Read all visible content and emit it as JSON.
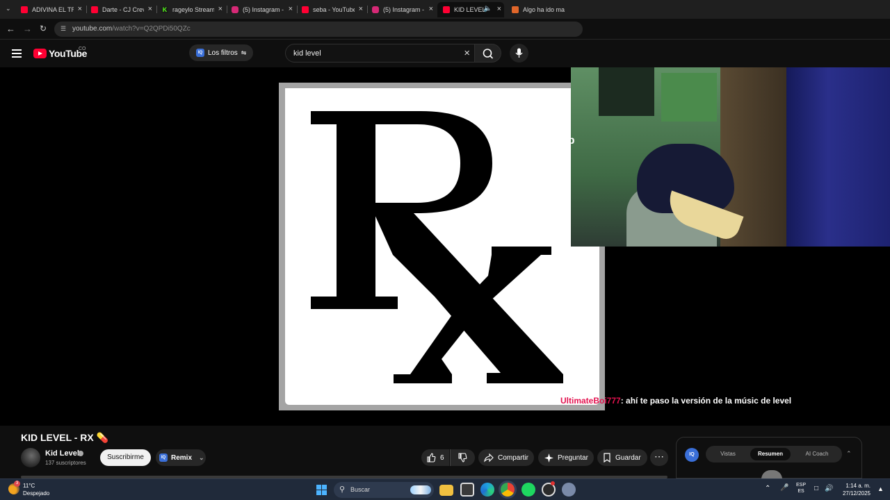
{
  "browser": {
    "tabs": [
      {
        "title": "ADIVINA EL TR",
        "favicon_color": "#ff0033"
      },
      {
        "title": "Darte - CJ Crev",
        "favicon_color": "#ff0033"
      },
      {
        "title": "rageylo Stream",
        "favicon_color": "#53fc18"
      },
      {
        "title": "(5) Instagram -",
        "favicon_color": "#d62976"
      },
      {
        "title": "seba - YouTube",
        "favicon_color": "#ff0033"
      },
      {
        "title": "(5) Instagram -",
        "favicon_color": "#d62976"
      },
      {
        "title": "KID LEVEL",
        "favicon_color": "#ff0033",
        "active": true
      },
      {
        "title": "Algo ha ido ma",
        "favicon_color": "#e0662a"
      }
    ],
    "url_host": "youtube.com",
    "url_path": "/watch?v=Q2QPDi50QZc"
  },
  "youtube": {
    "logo_text": "YouTube",
    "country_code": "CO",
    "filters_label": "Los filtros",
    "search_value": "kid level",
    "brand_color": "#ff0033"
  },
  "video": {
    "overlay_up": "up",
    "chat_user": "UltimateBoi777",
    "chat_message": ": ahí te paso la versión de la músic de level",
    "title": "KID LEVEL - RX 💊",
    "channel": "Kid Level",
    "subscribers": "137 suscriptores",
    "subscribe_label": "Suscribirme",
    "remix_label": "Remix",
    "like_count": "6",
    "share_label": "Compartir",
    "ask_label": "Preguntar",
    "save_label": "Guardar"
  },
  "side_panel": {
    "tabs": [
      "Vistas",
      "Resumen",
      "AI Coach"
    ],
    "selected": "Resumen"
  },
  "taskbar": {
    "weather_badge": "3",
    "temperature": "11°C",
    "condition": "Despejado",
    "search_label": "Buscar",
    "lang_line1": "ESP",
    "lang_line2": "ES",
    "time": "1:14 a. m.",
    "date": "27/12/2025"
  }
}
